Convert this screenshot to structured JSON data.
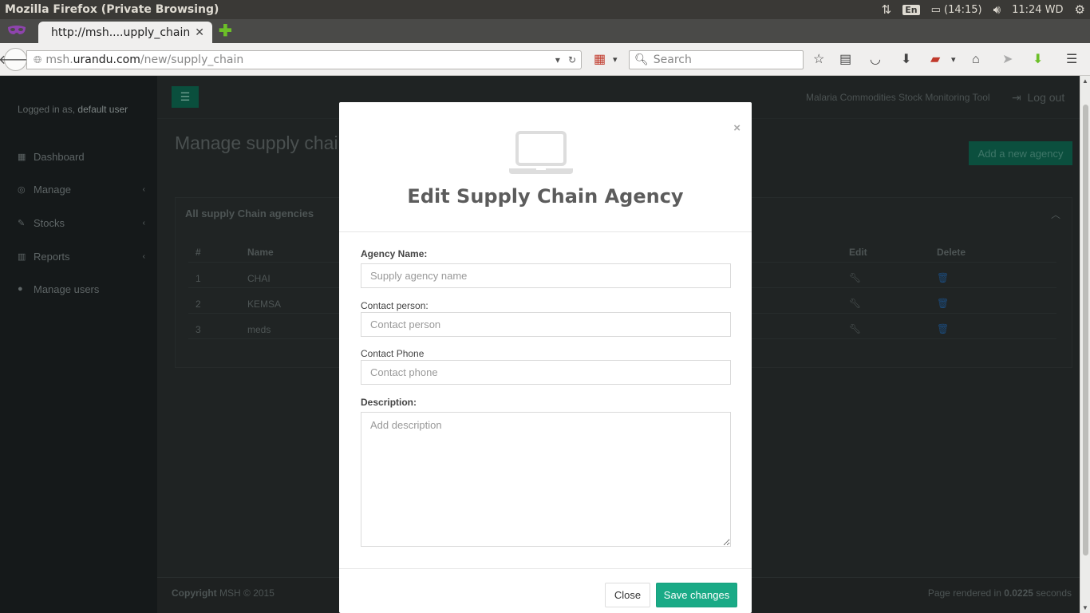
{
  "os": {
    "window_title": "Mozilla Firefox (Private Browsing)",
    "lang": "En",
    "battery": "(14:15)",
    "clock": "11:24 WD"
  },
  "browser": {
    "tab_title": "http://msh....upply_chain",
    "url_prefix": "msh.",
    "url_host": "urandu.com",
    "url_path": "/new/supply_chain",
    "search_placeholder": "Search"
  },
  "sidebar": {
    "logged_prefix": "Logged in as,",
    "user": "default user",
    "items": [
      {
        "label": "Dashboard",
        "icon": "dashboard-icon"
      },
      {
        "label": "Manage",
        "icon": "manage-icon"
      },
      {
        "label": "Stocks",
        "icon": "stocks-icon"
      },
      {
        "label": "Reports",
        "icon": "reports-icon"
      },
      {
        "label": "Manage users",
        "icon": "users-icon"
      }
    ]
  },
  "header": {
    "app_title": "Malaria Commodities Stock Monitoring Tool",
    "logout": "Log out"
  },
  "main": {
    "page_title": "Manage supply chain",
    "add_button": "Add a new agency",
    "panel_title": "All supply Chain agencies",
    "columns": [
      "#",
      "Name",
      "Edit",
      "Delete"
    ],
    "rows": [
      {
        "num": "1",
        "name": "CHAI"
      },
      {
        "num": "2",
        "name": "KEMSA"
      },
      {
        "num": "3",
        "name": "meds"
      }
    ]
  },
  "footer": {
    "copyright_label": "Copyright",
    "copyright_text": "MSH © 2015",
    "render_prefix": "Page rendered in",
    "render_time": "0.0225",
    "render_suffix": "seconds"
  },
  "modal": {
    "title": "Edit Supply Chain Agency",
    "close_x": "×",
    "fields": {
      "agency_name_label": "Agency Name:",
      "agency_name_placeholder": "Supply agency name",
      "contact_person_label": "Contact person:",
      "contact_person_placeholder": "Contact person",
      "contact_phone_label": "Contact Phone",
      "contact_phone_placeholder": "Contact phone",
      "description_label": "Description:",
      "description_placeholder": "Add description"
    },
    "close_button": "Close",
    "save_button": "Save changes"
  },
  "colors": {
    "accent": "#1aaa86",
    "sidebar_bg": "#15191a",
    "os_bar": "#3a3936"
  }
}
